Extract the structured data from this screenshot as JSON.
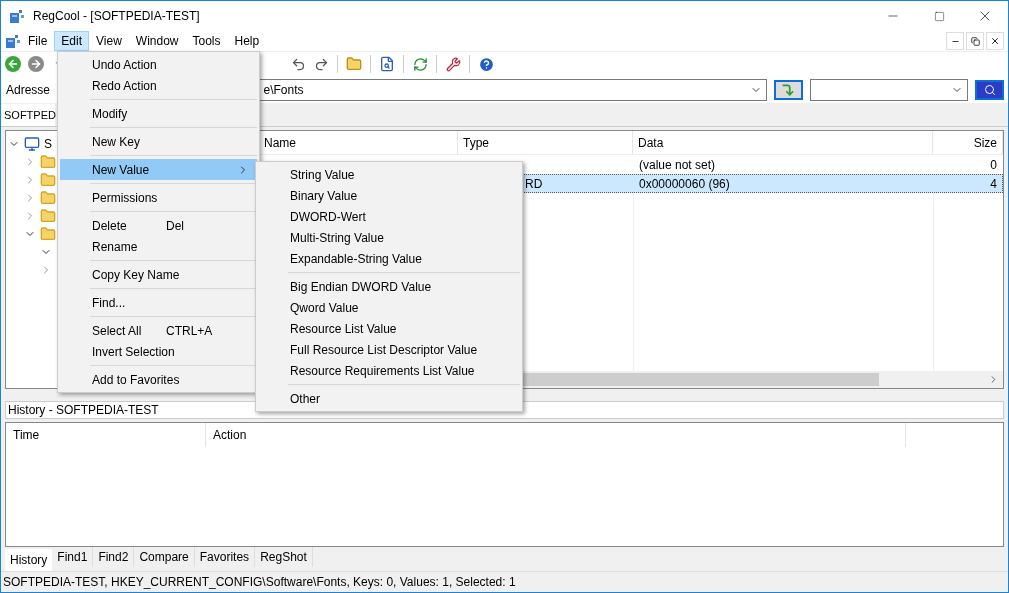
{
  "window": {
    "title": "RegCool - [SOFTPEDIA-TEST]"
  },
  "menu_bar": [
    {
      "label": "File",
      "selected": false
    },
    {
      "label": "Edit",
      "selected": true
    },
    {
      "label": "View",
      "selected": false
    },
    {
      "label": "Window",
      "selected": false
    },
    {
      "label": "Tools",
      "selected": false
    },
    {
      "label": "Help",
      "selected": false
    }
  ],
  "address": {
    "label": "Adresse",
    "value": "e\\Fonts"
  },
  "document_tab": {
    "label": "SOFTPED"
  },
  "tree": {
    "label": "S",
    "expanded": true,
    "children": [
      {
        "expanded": false
      },
      {
        "expanded": false
      },
      {
        "expanded": false
      },
      {
        "expanded": false
      },
      {
        "expanded": true,
        "children": [
          {
            "expanded": true
          },
          {
            "expanded": false
          }
        ]
      }
    ]
  },
  "table": {
    "columns": [
      "Name",
      "Type",
      "Data",
      "Size"
    ],
    "rows": [
      {
        "cells": [
          "",
          "",
          "(value not set)",
          "0"
        ],
        "selected": false
      },
      {
        "cells": [
          "",
          "RD",
          "0x00000060 (96)",
          "4"
        ],
        "selected": true
      }
    ]
  },
  "edit_menu": [
    {
      "kind": "item",
      "label": "Undo Action"
    },
    {
      "kind": "item",
      "label": "Redo Action"
    },
    {
      "kind": "separator"
    },
    {
      "kind": "item",
      "label": "Modify"
    },
    {
      "kind": "separator"
    },
    {
      "kind": "item",
      "label": "New Key"
    },
    {
      "kind": "separator"
    },
    {
      "kind": "submenu",
      "label": "New Value",
      "selected": true
    },
    {
      "kind": "separator"
    },
    {
      "kind": "item",
      "label": "Permissions"
    },
    {
      "kind": "separator"
    },
    {
      "kind": "item",
      "label": "Delete",
      "shortcut": "Del"
    },
    {
      "kind": "item",
      "label": "Rename"
    },
    {
      "kind": "separator"
    },
    {
      "kind": "item",
      "label": "Copy Key Name"
    },
    {
      "kind": "separator"
    },
    {
      "kind": "item",
      "label": "Find..."
    },
    {
      "kind": "separator"
    },
    {
      "kind": "item",
      "label": "Select All",
      "shortcut": "CTRL+A"
    },
    {
      "kind": "item",
      "label": "Invert Selection"
    },
    {
      "kind": "separator"
    },
    {
      "kind": "item",
      "label": "Add to Favorites"
    }
  ],
  "new_value_menu": [
    {
      "kind": "item",
      "label": "String Value"
    },
    {
      "kind": "item",
      "label": "Binary Value"
    },
    {
      "kind": "item",
      "label": "DWORD-Wert"
    },
    {
      "kind": "item",
      "label": "Multi-String Value"
    },
    {
      "kind": "item",
      "label": "Expandable-String Value"
    },
    {
      "kind": "separator"
    },
    {
      "kind": "item",
      "label": "Big Endian DWORD Value"
    },
    {
      "kind": "item",
      "label": "Qword Value"
    },
    {
      "kind": "item",
      "label": "Resource List Value"
    },
    {
      "kind": "item",
      "label": "Full Resource List Descriptor Value"
    },
    {
      "kind": "item",
      "label": "Resource Requirements List Value"
    },
    {
      "kind": "separator"
    },
    {
      "kind": "item",
      "label": "Other"
    }
  ],
  "history": {
    "title": "History - SOFTPEDIA-TEST",
    "columns": [
      "Time",
      "Action"
    ]
  },
  "bottom_tabs": [
    {
      "label": "History",
      "selected": true
    },
    {
      "label": "Find1",
      "selected": false
    },
    {
      "label": "Find2",
      "selected": false
    },
    {
      "label": "Compare",
      "selected": false
    },
    {
      "label": "Favorites",
      "selected": false
    },
    {
      "label": "RegShot",
      "selected": false
    }
  ],
  "status_bar": "SOFTPEDIA-TEST, HKEY_CURRENT_CONFIG\\Software\\Fonts, Keys: 0, Values: 1, Selected: 1"
}
